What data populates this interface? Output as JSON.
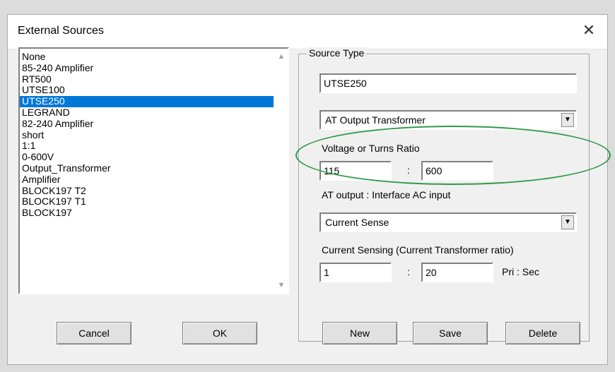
{
  "window": {
    "title": "External Sources",
    "close_glyph": "✕"
  },
  "sources": {
    "items": [
      "None",
      "85-240 Amplifier",
      "RT500",
      "UTSE100",
      "UTSE250",
      "LEGRAND",
      "82-240 Amplifier",
      "short",
      "1:1",
      "0-600V",
      "Output_Transformer",
      "Amplifier",
      "BLOCK197 T2",
      "BLOCK197 T1",
      "BLOCK197"
    ],
    "selected": "UTSE250"
  },
  "buttons": {
    "cancel": "Cancel",
    "ok": "OK",
    "new": "New",
    "save": "Save",
    "delete": "Delete"
  },
  "source_type": {
    "group_label": "Source Type",
    "name": "UTSE250",
    "type_select": "AT Output Transformer",
    "voltage_label": "Voltage or Turns Ratio",
    "voltage_left": "115",
    "voltage_sep": ":",
    "voltage_right": "600",
    "at_output_label": "AT output  :  Interface AC input",
    "sense_select": "Current Sense",
    "current_label": "Current Sensing (Current Transformer ratio)",
    "current_left": "1",
    "current_sep": ":",
    "current_right": "20",
    "ratio_unit": "Pri : Sec"
  },
  "highlight_color": "#2e9a4a"
}
